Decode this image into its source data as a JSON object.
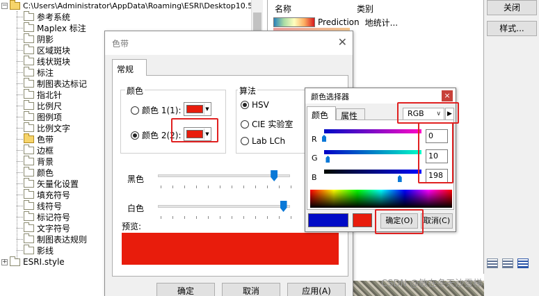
{
  "tree": {
    "path": "C:\\Users\\Administrator\\AppData\\Roaming\\ESRI\\Desktop10.5\\ArcM",
    "items": [
      "参考系统",
      "Maplex 标注",
      "阴影",
      "区域斑块",
      "线状斑块",
      "标注",
      "制图表达标记",
      "指北针",
      "比例尺",
      "图例项",
      "比例文字",
      "色带",
      "边框",
      "背景",
      "颜色",
      "矢量化设置",
      "填充符号",
      "线符号",
      "标记符号",
      "文字符号",
      "制图表达规则",
      "影线"
    ],
    "bottom_item": "ESRI.style",
    "selected_item": "色带"
  },
  "list": {
    "col_name": "名称",
    "col_category": "类别",
    "row1_name": "Prediction",
    "row1_category": "地统计..."
  },
  "side_buttons": {
    "close": "关闭",
    "styles": "样式..."
  },
  "watermark": "CSDN @敏在冬天沙雪梯",
  "ramp_dialog": {
    "title": "色带",
    "tab": "常规",
    "group_color": "颜色",
    "color1_label": "颜色 1(1):",
    "color2_label": "颜色 2(2):",
    "group_algorithm": "算法",
    "algo_options": [
      "HSV",
      "CIE 实验室",
      "Lab LCh"
    ],
    "algo_selected": "HSV",
    "dark_label": "黑色",
    "light_label": "白色",
    "preview_label": "预览:",
    "dark_value": 0.88,
    "light_value": 0.95,
    "ok": "确定",
    "cancel": "取消",
    "apply": "应用(A)",
    "color1_hex": "#e81c0c",
    "color2_hex": "#e81c0c"
  },
  "picker": {
    "title": "颜色选择器",
    "tab_color": "颜色",
    "tab_properties": "属性",
    "mode": "RGB",
    "r_label": "R",
    "g_label": "G",
    "b_label": "B",
    "r_value": "0",
    "g_value": "10",
    "b_value": "198",
    "ok": "确定(O)",
    "cancel": "取消(C)",
    "new_color_hex": "#000ac6",
    "old_color_hex": "#e81c0c"
  }
}
